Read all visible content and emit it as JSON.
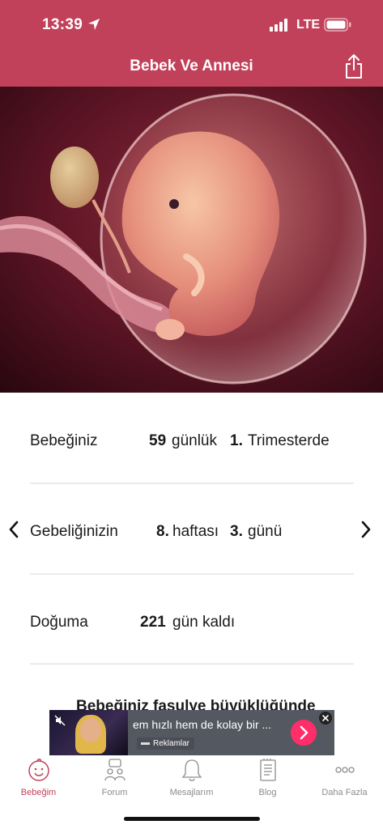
{
  "status_bar": {
    "time": "13:39",
    "network": "LTE"
  },
  "header": {
    "title": "Bebek Ve Annesi"
  },
  "baby_info": {
    "row1": {
      "label": "Bebeğiniz",
      "days_value": "59",
      "days_unit": "günlük",
      "trimester_value": "1.",
      "trimester_unit": "Trimesterde"
    },
    "row2": {
      "label": "Gebeliğinizin",
      "week_value": "8.",
      "week_unit": "haftası",
      "day_value": "3.",
      "day_unit": "günü"
    },
    "row3": {
      "label": "Doğuma",
      "remaining_value": "221",
      "remaining_unit": "gün kaldı"
    }
  },
  "size_teaser": "Bebeğiniz fasulye büyüklüğünde",
  "ad": {
    "text": "em hızlı hem de kolay bir ...",
    "badge": "Reklamlar"
  },
  "tabs": [
    {
      "label": "Bebeğim",
      "icon": "baby-face-icon",
      "active": true
    },
    {
      "label": "Forum",
      "icon": "forum-icon",
      "active": false
    },
    {
      "label": "Mesajlarım",
      "icon": "bell-icon",
      "active": false
    },
    {
      "label": "Blog",
      "icon": "blog-icon",
      "active": false
    },
    {
      "label": "Daha Fazla",
      "icon": "more-icon",
      "active": false
    }
  ],
  "colors": {
    "brand": "#c2415a",
    "tab_inactive": "#8c8c8c",
    "ad_accent": "#ff2d6a"
  }
}
